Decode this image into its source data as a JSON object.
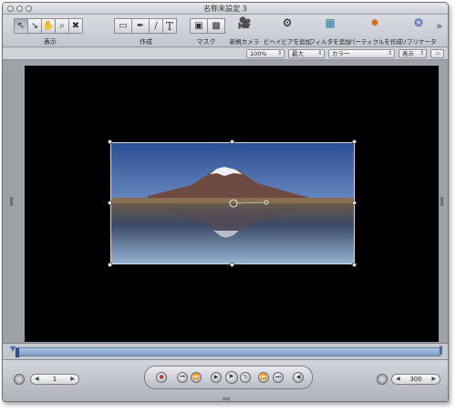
{
  "window": {
    "title": "名称未設定 3"
  },
  "toolbar": {
    "groups": {
      "view_label": "表示",
      "create_label": "作成",
      "mask_label": "マスク"
    },
    "actions": {
      "new_camera": "新規カメラ",
      "add_behavior": "ビヘイビアを追加",
      "add_filter": "フィルタを追加",
      "make_particles": "パーティクルを作成",
      "replicate": "リプリケータ"
    }
  },
  "options_bar": {
    "zoom": "100%",
    "resolution": "最大",
    "channels": "カラー",
    "view": "表示"
  },
  "transport": {
    "current_frame": "1",
    "end_frame": "300"
  },
  "colors": {
    "canvas": "#000000",
    "timeline_bar": "#8fb0d4",
    "record": "#c0392b"
  }
}
